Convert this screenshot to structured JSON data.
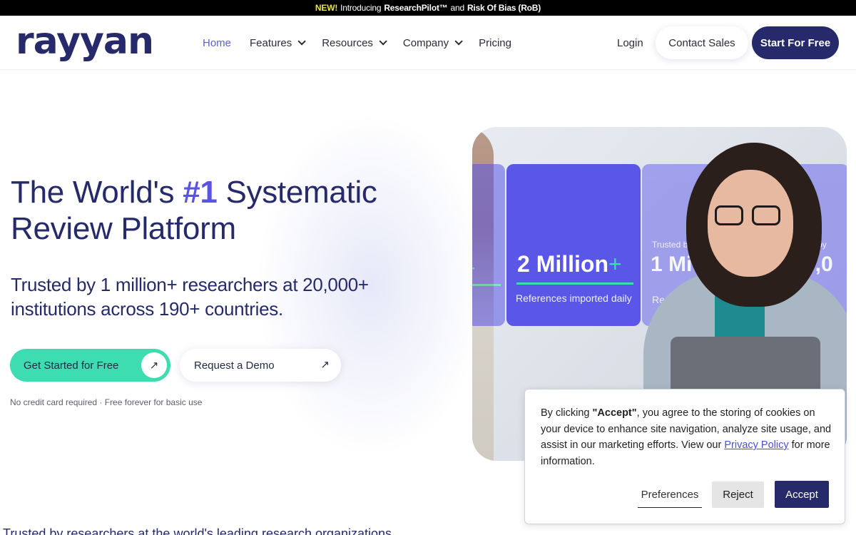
{
  "announcement": {
    "new_label": "NEW!",
    "intro_text": "Introducing",
    "product_1": "ResearchPilot™",
    "and_text": "and",
    "product_2": "Risk Of Bias (RoB)"
  },
  "header": {
    "logo_text": "rayyan",
    "nav": [
      {
        "label": "Home",
        "active": true,
        "dropdown": false
      },
      {
        "label": "Features",
        "active": false,
        "dropdown": true
      },
      {
        "label": "Resources",
        "active": false,
        "dropdown": true
      },
      {
        "label": "Company",
        "active": false,
        "dropdown": true
      },
      {
        "label": "Pricing",
        "active": false,
        "dropdown": false
      }
    ],
    "login_label": "Login",
    "contact_sales_label": "Contact Sales",
    "start_free_label": "Start For Free"
  },
  "hero": {
    "title_part1": "The World's",
    "title_highlight": "#1",
    "title_part2": "Systematic",
    "title_line2": "Review Platform",
    "subtitle": "Trusted by 1 million+ researchers at 20,000+ institutions across 190+ countries.",
    "cta_primary": "Get Started for Free",
    "cta_secondary": "Request a Demo",
    "note": "No credit card required · Free forever for basic use"
  },
  "hero_image": {
    "main_stat": "2 Million",
    "main_stat_plus": "+",
    "main_caption": "References imported daily",
    "right_small_label": "Trusted by",
    "right_stat": "1 Mi",
    "right_caption": "Rese",
    "right_small_label_2": "sted by",
    "right_stat_2": "0,0",
    "left_plus": "+"
  },
  "bottom": {
    "text": "Trusted by researchers at the world's leading research organizations"
  },
  "cookie": {
    "text_before": "By clicking",
    "accept_quoted": "\"Accept\"",
    "text_after": ", you agree to the storing of cookies on your device to enhance site navigation, analyze site usage, and assist in our marketing efforts. View our",
    "privacy_link": "Privacy Policy",
    "text_end": "for more information.",
    "preferences_label": "Preferences",
    "reject_label": "Reject",
    "accept_label": "Accept"
  },
  "colors": {
    "brand_navy": "#262a6b",
    "accent_purple": "#5b52e6",
    "accent_teal": "#3ddcb1"
  }
}
